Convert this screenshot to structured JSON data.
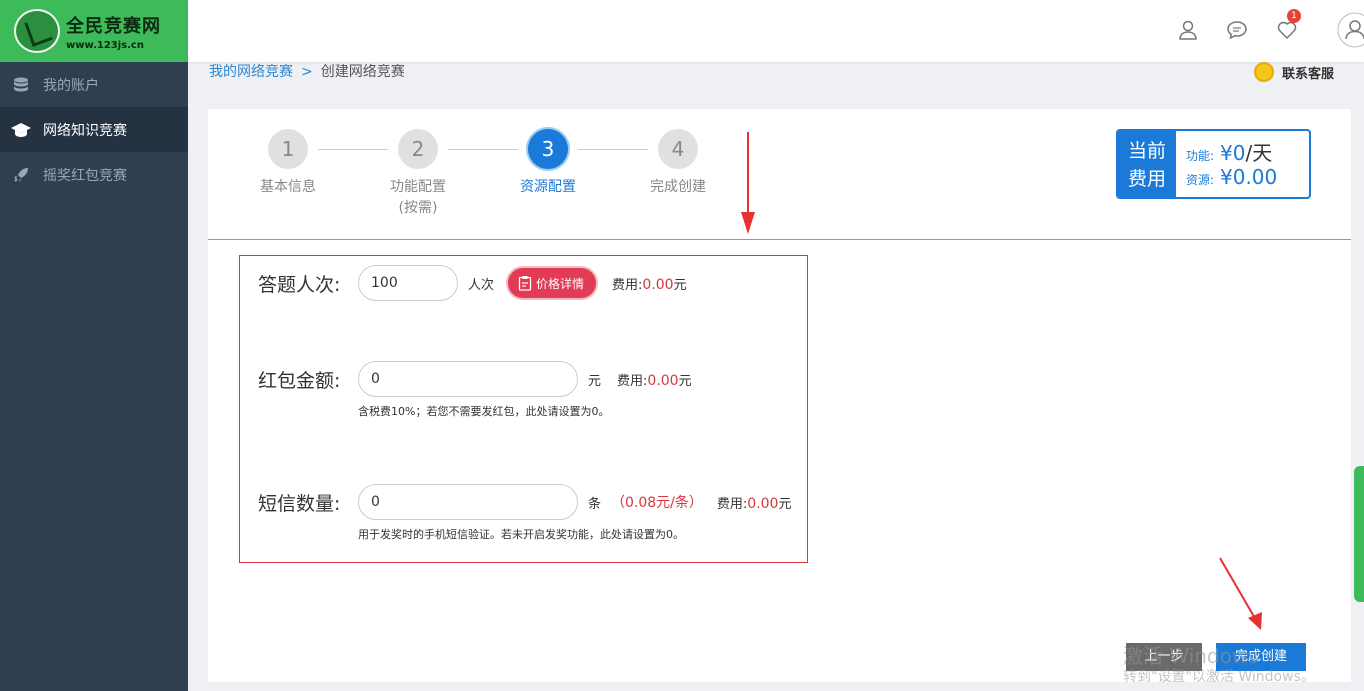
{
  "brand": {
    "title": "全民竞赛网",
    "subtitle": "www.123js.cn"
  },
  "sidebar": {
    "items": [
      {
        "label": "我的账户",
        "icon": "database-icon",
        "active": false
      },
      {
        "label": "网络知识竞赛",
        "icon": "graduation-cap-icon",
        "active": true
      },
      {
        "label": "摇奖红包竞赛",
        "icon": "rocket-icon",
        "active": false
      }
    ]
  },
  "topbar": {
    "notification_count": "1",
    "icons": [
      "user-icon",
      "chat-icon",
      "heart-icon",
      "avatar-icon"
    ]
  },
  "breadcrumb": {
    "parent": "我的网络竞赛",
    "separator": ">",
    "current": "创建网络竞赛"
  },
  "support": {
    "label": "联系客服"
  },
  "steps": [
    {
      "number": "1",
      "label": "基本信息",
      "sub": ""
    },
    {
      "number": "2",
      "label": "功能配置",
      "sub": "(按需)"
    },
    {
      "number": "3",
      "label": "资源配置",
      "sub": "",
      "active": true
    },
    {
      "number": "4",
      "label": "完成创建",
      "sub": ""
    }
  ],
  "cost": {
    "title_line1": "当前",
    "title_line2": "费用",
    "function_label": "功能:",
    "function_value": "¥0",
    "function_unit": "/天",
    "resource_label": "资源:",
    "resource_value": "¥0.00"
  },
  "form": {
    "answers": {
      "label": "答题人次:",
      "value": "100",
      "unit": "人次",
      "price_button": "价格详情",
      "fee_label": "费用:",
      "fee_value": "0.00",
      "fee_unit": "元"
    },
    "redpacket": {
      "label": "红包金额:",
      "value": "0",
      "unit": "元",
      "fee_label": "费用:",
      "fee_value": "0.00",
      "fee_unit": "元",
      "hint": "含税费10%；若您不需要发红包，此处请设置为0。"
    },
    "sms": {
      "label": "短信数量:",
      "value": "0",
      "unit": "条",
      "price": "（0.08元/条）",
      "fee_label": "费用:",
      "fee_value": "0.00",
      "fee_unit": "元",
      "hint": "用于发奖时的手机短信验证。若未开启发奖功能，此处请设置为0。"
    }
  },
  "buttons": {
    "prev": "上一步",
    "finish": "完成创建"
  },
  "watermark": {
    "line1": "激活 Windows",
    "line2": "转到\"设置\"以激活 Windows。"
  },
  "colors": {
    "accent": "#1b7ad8",
    "brand_green": "#3dbb5a",
    "sidebar_bg": "#2f3f52",
    "danger": "#d9363e"
  }
}
